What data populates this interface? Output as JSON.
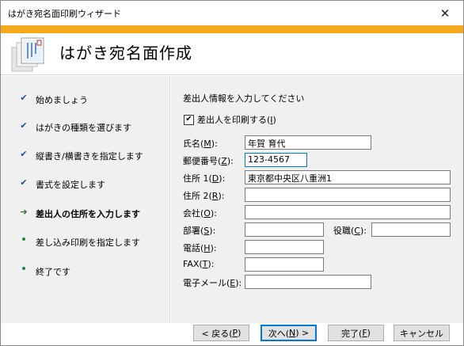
{
  "window": {
    "title": "はがき宛名面印刷ウィザード",
    "close_glyph": "✕"
  },
  "header": {
    "title": "はがき宛名面作成"
  },
  "steps": [
    {
      "label": "始めましょう",
      "state": "done",
      "mark": "✔"
    },
    {
      "label": "はがきの種類を選びます",
      "state": "done",
      "mark": "✔"
    },
    {
      "label": "縦書き/横書きを指定します",
      "state": "done",
      "mark": "✔"
    },
    {
      "label": "書式を設定します",
      "state": "done",
      "mark": "✔"
    },
    {
      "label": "差出人の住所を入力します",
      "state": "current",
      "mark": "➔"
    },
    {
      "label": "差し込み印刷を指定します",
      "state": "pending",
      "mark": "•"
    },
    {
      "label": "終了です",
      "state": "pending",
      "mark": "•"
    }
  ],
  "form": {
    "heading": "差出人情報を入力してください",
    "print_sender": {
      "prefix": "差出人を印刷する(",
      "key": "I",
      "suffix": ")",
      "checked": true,
      "check_glyph": "✔"
    },
    "name": {
      "prefix": "氏名(",
      "key": "M",
      "suffix": "):",
      "value": "年賀 育代"
    },
    "postal": {
      "prefix": "郵便番号(",
      "key": "Z",
      "suffix": "):",
      "value": "123-4567"
    },
    "address1": {
      "prefix": "住所 1(",
      "key": "D",
      "suffix": "):",
      "value": "東京都中央区八重洲1"
    },
    "address2": {
      "prefix": "住所 2(",
      "key": "R",
      "suffix": "):",
      "value": ""
    },
    "company": {
      "prefix": "会社(",
      "key": "O",
      "suffix": "):",
      "value": ""
    },
    "department": {
      "prefix": "部署(",
      "key": "S",
      "suffix": "):",
      "value": ""
    },
    "title": {
      "prefix": "役職(",
      "key": "C",
      "suffix": "):",
      "value": ""
    },
    "phone": {
      "prefix": "電話(",
      "key": "H",
      "suffix": "):",
      "value": ""
    },
    "fax": {
      "prefix": "FAX(",
      "key": "T",
      "suffix": "):",
      "value": ""
    },
    "email": {
      "prefix": "電子メール(",
      "key": "E",
      "suffix": "):",
      "value": ""
    }
  },
  "buttons": {
    "back": {
      "prefix": "< 戻る(",
      "key": "P",
      "suffix": ")"
    },
    "next": {
      "prefix": "次へ(",
      "key": "N",
      "suffix": ") >"
    },
    "finish": {
      "prefix": "完了(",
      "key": "F",
      "suffix": ")"
    },
    "cancel": {
      "label": "キャンセル"
    }
  },
  "colors": {
    "accent": "#f5a820",
    "pane": "#f0f0f0",
    "check": "#1b4fa8",
    "arrow": "#2f6b2f",
    "bullet": "#1d8a3a"
  }
}
